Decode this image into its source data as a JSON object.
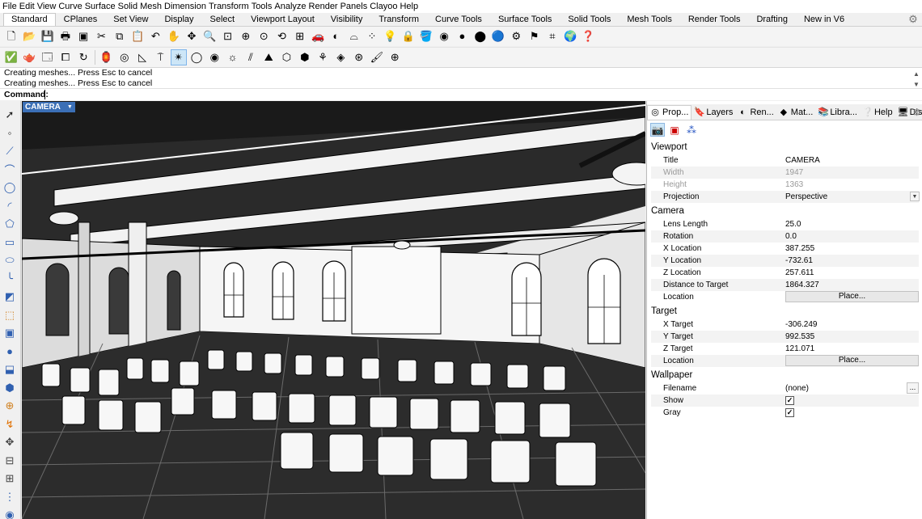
{
  "menu": [
    "File",
    "Edit",
    "View",
    "Curve",
    "Surface",
    "Solid",
    "Mesh",
    "Dimension",
    "Transform",
    "Tools",
    "Analyze",
    "Render",
    "Panels",
    "Clayoo",
    "Help"
  ],
  "tabs": [
    {
      "label": "Standard",
      "active": true
    },
    {
      "label": "CPlanes"
    },
    {
      "label": "Set View"
    },
    {
      "label": "Display"
    },
    {
      "label": "Select"
    },
    {
      "label": "Viewport Layout"
    },
    {
      "label": "Visibility"
    },
    {
      "label": "Transform"
    },
    {
      "label": "Curve Tools"
    },
    {
      "label": "Surface Tools"
    },
    {
      "label": "Solid Tools"
    },
    {
      "label": "Mesh Tools"
    },
    {
      "label": "Render Tools"
    },
    {
      "label": "Drafting"
    },
    {
      "label": "New in V6"
    }
  ],
  "toolbar1": [
    {
      "icon": "new-file-icon",
      "glyph": "🗋"
    },
    {
      "icon": "open-folder-icon",
      "glyph": "📂"
    },
    {
      "icon": "save-icon",
      "glyph": "💾"
    },
    {
      "icon": "print-icon",
      "glyph": "🖶"
    },
    {
      "icon": "save-small-icon",
      "glyph": "▣"
    },
    {
      "icon": "cut-icon",
      "glyph": "✂"
    },
    {
      "icon": "copy-icon",
      "glyph": "⧉"
    },
    {
      "icon": "paste-icon",
      "glyph": "📋"
    },
    {
      "icon": "undo-icon",
      "glyph": "↶"
    },
    {
      "icon": "pan-hand-icon",
      "glyph": "✋"
    },
    {
      "icon": "rotate-view-icon",
      "glyph": "✥"
    },
    {
      "icon": "zoom-icon",
      "glyph": "🔍"
    },
    {
      "icon": "zoom-window-icon",
      "glyph": "⊡"
    },
    {
      "icon": "zoom-extents-icon",
      "glyph": "⊕"
    },
    {
      "icon": "zoom-selected-icon",
      "glyph": "⊙"
    },
    {
      "icon": "undo-view-icon",
      "glyph": "⟲"
    },
    {
      "icon": "four-viewports-icon",
      "glyph": "⊞"
    },
    {
      "icon": "car-icon",
      "glyph": "🚗"
    },
    {
      "icon": "shade-icon",
      "glyph": "◐"
    },
    {
      "icon": "plane-icon",
      "glyph": "⌓"
    },
    {
      "icon": "select-points-icon",
      "glyph": "⁘"
    },
    {
      "icon": "light-bulb-icon",
      "glyph": "💡"
    },
    {
      "icon": "lock-icon",
      "glyph": "🔒"
    },
    {
      "icon": "paint-bucket-icon",
      "glyph": "🪣"
    },
    {
      "icon": "color-wheel-icon",
      "glyph": "◉"
    },
    {
      "icon": "sphere-shaded-icon",
      "glyph": "●"
    },
    {
      "icon": "sphere-render-icon",
      "glyph": "⬤"
    },
    {
      "icon": "sphere-blue-icon",
      "glyph": "🔵"
    },
    {
      "icon": "gears-icon",
      "glyph": "⚙"
    },
    {
      "icon": "flag-icon",
      "glyph": "⚑"
    },
    {
      "icon": "grid-snap-icon",
      "glyph": "⌗"
    },
    {
      "icon": "globe-icon",
      "glyph": "🌍"
    },
    {
      "icon": "help-icon",
      "glyph": "❓"
    }
  ],
  "toolbar2": [
    {
      "icon": "check-circle-icon",
      "glyph": "✅"
    },
    {
      "icon": "teapot-icon",
      "glyph": "🫖"
    },
    {
      "icon": "render-preview-icon",
      "glyph": "🗔"
    },
    {
      "icon": "render-window-icon",
      "glyph": "⧠"
    },
    {
      "icon": "orbit-icon",
      "glyph": "↻"
    },
    {
      "icon": "spotlight-icon",
      "glyph": "🏮"
    },
    {
      "icon": "target-light-icon",
      "glyph": "◎"
    },
    {
      "icon": "ground-plane-icon",
      "glyph": "◺"
    },
    {
      "icon": "directional-light-icon",
      "glyph": "⍑"
    },
    {
      "icon": "sun-star-icon",
      "glyph": "✴",
      "selected": true
    },
    {
      "icon": "point-light-icon",
      "glyph": "◯"
    },
    {
      "icon": "rectangular-light-icon",
      "glyph": "◉"
    },
    {
      "icon": "sun-icon",
      "glyph": "☼"
    },
    {
      "icon": "linear-light-icon",
      "glyph": "⫽"
    },
    {
      "icon": "environment-icon",
      "glyph": "⛰"
    },
    {
      "icon": "box-mapping-icon",
      "glyph": "⬡"
    },
    {
      "icon": "texture-box-icon",
      "glyph": "⬢"
    },
    {
      "icon": "plant-icon",
      "glyph": "⚘"
    },
    {
      "icon": "decal-icon",
      "glyph": "◈"
    },
    {
      "icon": "sphere-grid-icon",
      "glyph": "⊛"
    },
    {
      "icon": "brush-icon",
      "glyph": "🖌"
    },
    {
      "icon": "crosshair-icon",
      "glyph": "⊕"
    }
  ],
  "command": {
    "history": [
      "Creating meshes... Press Esc to cancel",
      "Creating meshes... Press Esc to cancel"
    ],
    "prompt": "Command:"
  },
  "left_toolbar": [
    "select-arrow-icon",
    "point-icon",
    "polyline-icon",
    "curve-icon",
    "circle-icon",
    "arc-icon",
    "polygon-icon",
    "rectangle-icon",
    "ellipse-icon",
    "fillet-curve-icon",
    "surface-icon",
    "extrude-icon",
    "box-solid-icon",
    "sphere-solid-icon",
    "cylinder-solid-icon",
    "mesh-icon",
    "boolean-icon",
    "transform-icon",
    "move-icon",
    "align-icon",
    "group-icon",
    "array-icon",
    "layer-icon"
  ],
  "viewport": {
    "title": "CAMERA"
  },
  "panel": {
    "tabs": [
      {
        "label": "Prop...",
        "icon": "properties-icon",
        "active": true
      },
      {
        "label": "Layers",
        "icon": "layers-icon"
      },
      {
        "label": "Ren...",
        "icon": "rendering-icon"
      },
      {
        "label": "Mat...",
        "icon": "materials-icon"
      },
      {
        "label": "Libra...",
        "icon": "libraries-icon"
      },
      {
        "label": "Help",
        "icon": "help-panel-icon"
      },
      {
        "label": "Displ...",
        "icon": "display-icon"
      }
    ],
    "sub_icons": [
      "camera-icon",
      "viewport-frame-icon",
      "color-balls-icon"
    ],
    "sections": {
      "viewport": {
        "header": "Viewport",
        "title_label": "Title",
        "title_value": "CAMERA",
        "width_label": "Width",
        "width_value": "1947",
        "height_label": "Height",
        "height_value": "1363",
        "projection_label": "Projection",
        "projection_value": "Perspective"
      },
      "camera": {
        "header": "Camera",
        "lens_label": "Lens Length",
        "lens_value": "25.0",
        "rotation_label": "Rotation",
        "rotation_value": "0.0",
        "x_label": "X Location",
        "x_value": "387.255",
        "y_label": "Y Location",
        "y_value": "-732.61",
        "z_label": "Z Location",
        "z_value": "257.611",
        "dist_label": "Distance to Target",
        "dist_value": "1864.327",
        "location_label": "Location",
        "place_button": "Place..."
      },
      "target": {
        "header": "Target",
        "x_label": "X Target",
        "x_value": "-306.249",
        "y_label": "Y Target",
        "y_value": "992.535",
        "z_label": "Z Target",
        "z_value": "121.071",
        "location_label": "Location",
        "place_button": "Place..."
      },
      "wallpaper": {
        "header": "Wallpaper",
        "filename_label": "Filename",
        "filename_value": "(none)",
        "show_label": "Show",
        "show_checked": true,
        "gray_label": "Gray",
        "gray_checked": true,
        "dots": "...",
        "check_glyph": "✓"
      }
    }
  }
}
